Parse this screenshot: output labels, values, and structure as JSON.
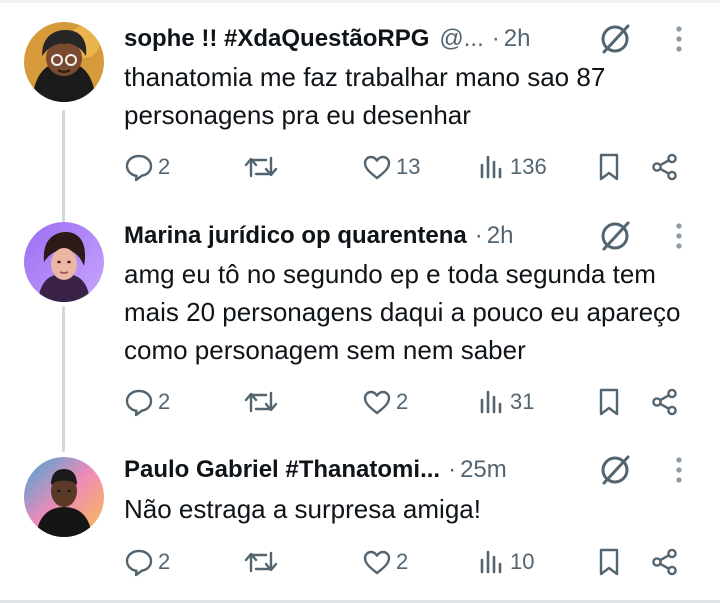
{
  "tweets": [
    {
      "name": "sophe !! #XdaQuestãoRPG",
      "handle": "@...",
      "separator": "·",
      "time": "2h",
      "text": "thanatomia me faz trabalhar mano sao 87 personagens pra eu desenhar",
      "replies": "2",
      "reposts": "",
      "likes": "13",
      "views": "136",
      "avatar_icon": "illustrated-character-avatar"
    },
    {
      "name": "Marina jurídico op quarentena",
      "handle": "",
      "separator": "·",
      "time": "2h",
      "text": "amg eu tô no segundo ep e toda segunda tem mais 20 personagens daqui a pouco eu apareço como personagem sem nem saber",
      "replies": "2",
      "reposts": "",
      "likes": "2",
      "views": "31",
      "avatar_icon": "photo-avatar-purple"
    },
    {
      "name": "Paulo Gabriel #Thanatomi...",
      "handle": "",
      "separator": "·",
      "time": "25m",
      "text": "Não estraga a surpresa amiga!",
      "replies": "2",
      "reposts": "",
      "likes": "2",
      "views": "10",
      "avatar_icon": "photo-avatar-man"
    }
  ],
  "colors": {
    "text": "#0f1419",
    "secondary": "#536471",
    "thread_line": "#cfd9de"
  }
}
